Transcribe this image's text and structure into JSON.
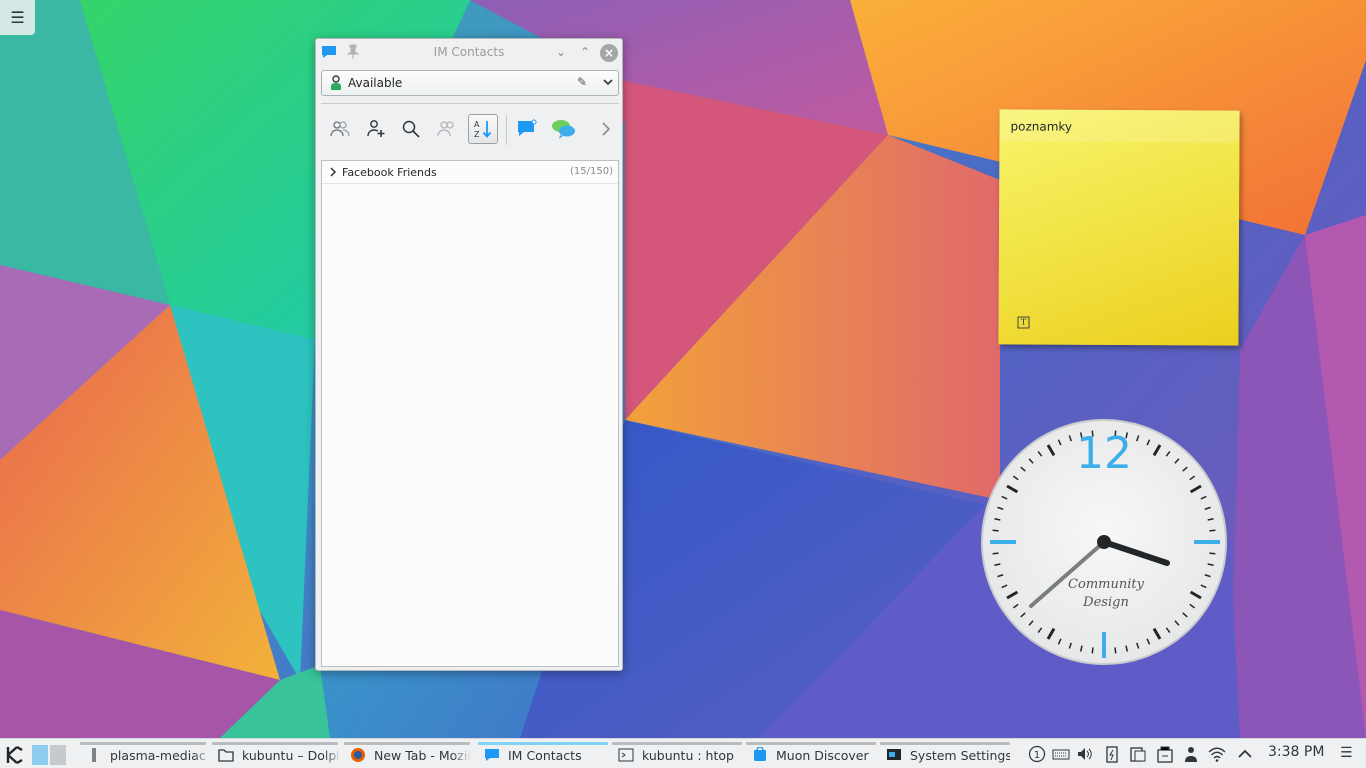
{
  "desktop": {
    "toolbox_icon": "hamburger-icon"
  },
  "im_window": {
    "title": "IM Contacts",
    "status": {
      "label": "Available",
      "icon": "person-online-icon"
    },
    "toolbar": {
      "buttons": [
        "show-offline-icon",
        "add-contact-icon",
        "search-icon",
        "groups-icon",
        "sort-az-icon",
        "chat-icon",
        "social-chat-icon",
        "more-icon"
      ]
    },
    "groups": [
      {
        "name": "Facebook Friends",
        "count": "(15/150)"
      }
    ]
  },
  "sticky_note": {
    "text": "poznamky"
  },
  "clock": {
    "twelve": "12",
    "brand_line1": "Community",
    "brand_line2": "Design",
    "time_shown": "3:38",
    "colors": {
      "accent": "#3daee9",
      "face": "#eff0f1",
      "hands": "#232629"
    }
  },
  "taskbar": {
    "tasks": [
      {
        "label": "plasma-mediace",
        "icon": "media-icon"
      },
      {
        "label": "kubuntu – Dolph",
        "icon": "folder-icon"
      },
      {
        "label": "New Tab - Mozil",
        "icon": "firefox-icon"
      },
      {
        "label": "IM Contacts",
        "icon": "chat-icon"
      },
      {
        "label": "kubuntu : htop",
        "icon": "terminal-icon"
      },
      {
        "label": "Muon Discover",
        "icon": "discover-icon"
      },
      {
        "label": "System Settings",
        "icon": "settings-icon"
      }
    ],
    "tray_badge": "1",
    "clock": "3:38 PM"
  }
}
